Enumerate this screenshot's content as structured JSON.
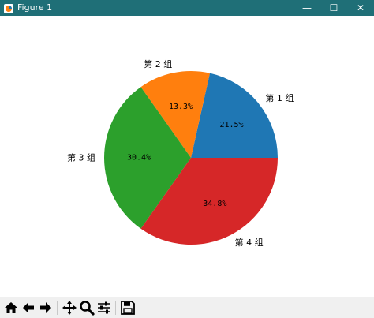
{
  "window": {
    "title": "Figure 1",
    "minimize_glyph": "—",
    "maximize_glyph": "☐",
    "close_glyph": "✕"
  },
  "chart_data": {
    "type": "pie",
    "labels": [
      "第 1 组",
      "第 2 组",
      "第 3 组",
      "第 4 组"
    ],
    "values": [
      21.5,
      13.3,
      30.4,
      34.8
    ],
    "value_labels": [
      "21.5%",
      "13.3%",
      "30.4%",
      "34.8%"
    ],
    "colors": [
      "#1f77b4",
      "#ff7f0e",
      "#2ca02c",
      "#d62728"
    ],
    "start_angle": 0,
    "direction": "counterclockwise",
    "legend": "none"
  },
  "toolbar": {
    "icons": [
      "home-icon",
      "back-icon",
      "forward-icon",
      "pan-icon",
      "zoom-icon",
      "configure-subplots-icon",
      "save-icon"
    ]
  }
}
